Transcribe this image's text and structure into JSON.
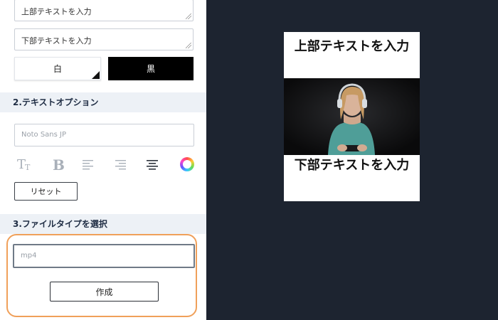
{
  "top_text": {
    "value": "上部テキストを入力"
  },
  "bottom_text": {
    "value": "下部テキストを入力"
  },
  "color_options": {
    "white": "白",
    "black": "黒"
  },
  "section2": {
    "title": "2.テキストオプション"
  },
  "font": {
    "value": "Noto Sans JP"
  },
  "toolbar": {
    "icons": [
      "text-size-icon",
      "bold-icon",
      "align-left-icon",
      "align-right-icon",
      "align-center-icon",
      "color-wheel-icon"
    ]
  },
  "reset": {
    "label": "リセット"
  },
  "section3": {
    "title": "3.ファイルタイプを選択"
  },
  "file_type": {
    "value": "mp4"
  },
  "create": {
    "label": "作成"
  },
  "preview": {
    "top_caption": "上部テキストを入力",
    "bottom_caption": "下部テキストを入力"
  },
  "colors": {
    "dark_bg": "#1d2430",
    "highlight": "#f0a05a",
    "section_bg": "#edf1f6"
  }
}
